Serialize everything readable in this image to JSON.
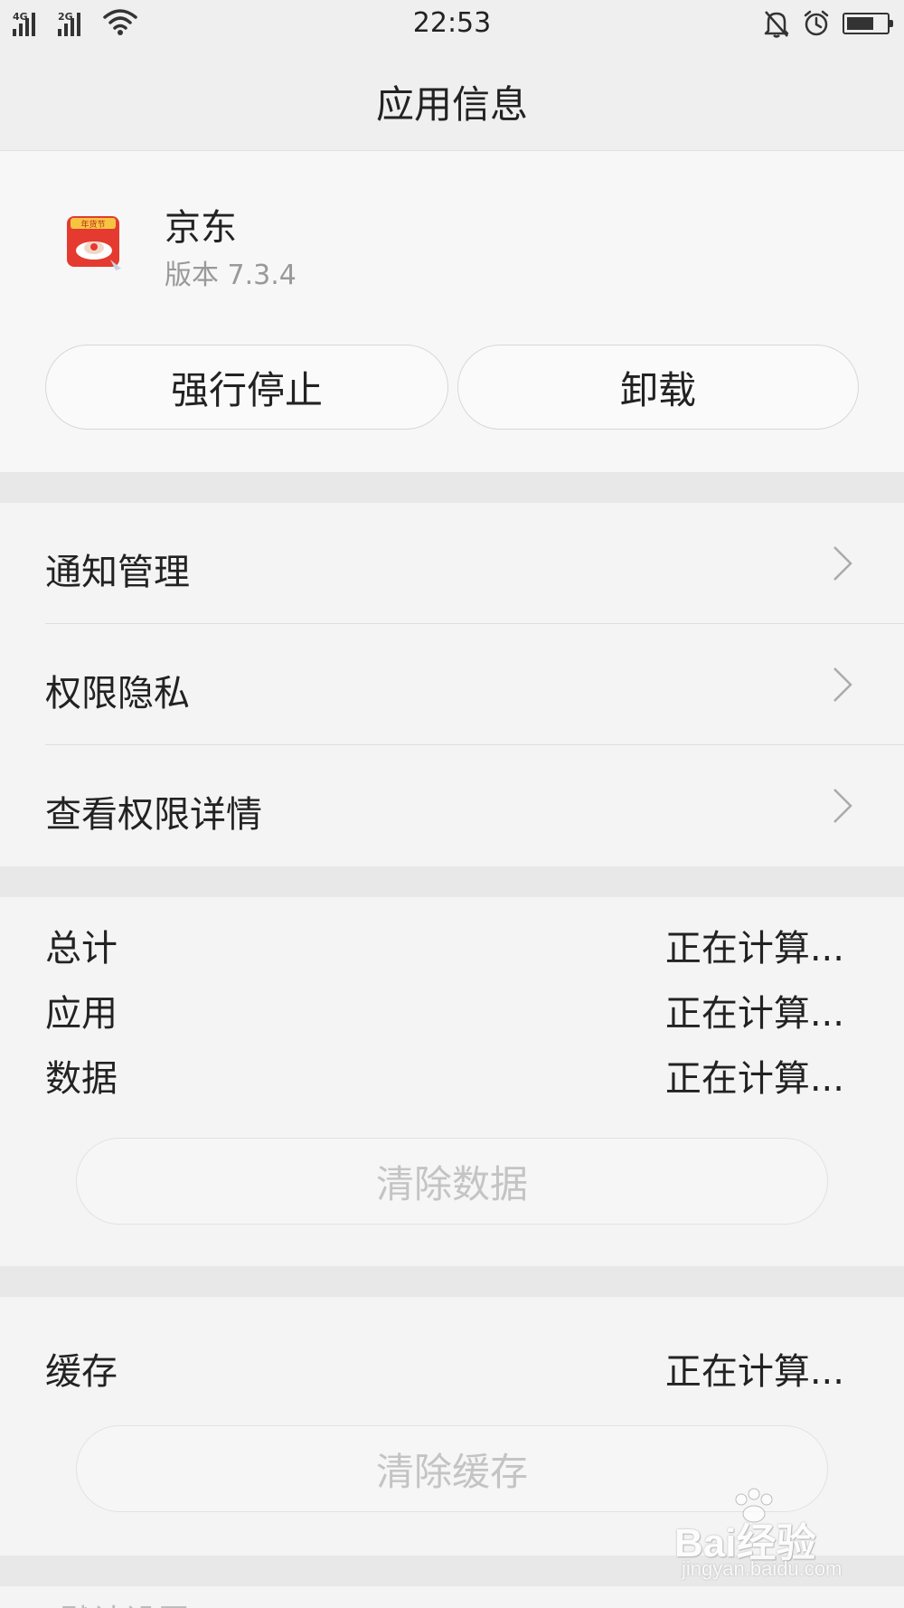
{
  "status_bar": {
    "signal_1_label": "4G",
    "signal_2_label": "2G",
    "time": "22:53",
    "battery_level": 0.7,
    "icons": [
      "signal-icon",
      "wifi-icon",
      "mute-bell-icon",
      "alarm-icon",
      "battery-icon"
    ]
  },
  "header": {
    "title": "应用信息"
  },
  "app": {
    "name": "京东",
    "version": "版本 7.3.4",
    "icon_text": "年货节",
    "force_stop_label": "强行停止",
    "uninstall_label": "卸载"
  },
  "menu": {
    "items": [
      {
        "label": "通知管理"
      },
      {
        "label": "权限隐私"
      },
      {
        "label": "查看权限详情"
      }
    ]
  },
  "storage": {
    "rows": [
      {
        "label": "总计",
        "value": "正在计算..."
      },
      {
        "label": "应用",
        "value": "正在计算..."
      },
      {
        "label": "数据",
        "value": "正在计算..."
      }
    ],
    "clear_data_label": "清除数据"
  },
  "cache": {
    "label": "缓存",
    "value": "正在计算...",
    "clear_cache_label": "清除缓存"
  },
  "footer_peek": "默认设置",
  "watermark": {
    "brand": "Bai经验",
    "url": "jingyan.baidu.com"
  },
  "colors": {
    "accent_red": "#e53a2f",
    "background": "#f5f5f5",
    "gap": "#e8e8e8",
    "disabled_text": "#c4c4c4"
  }
}
